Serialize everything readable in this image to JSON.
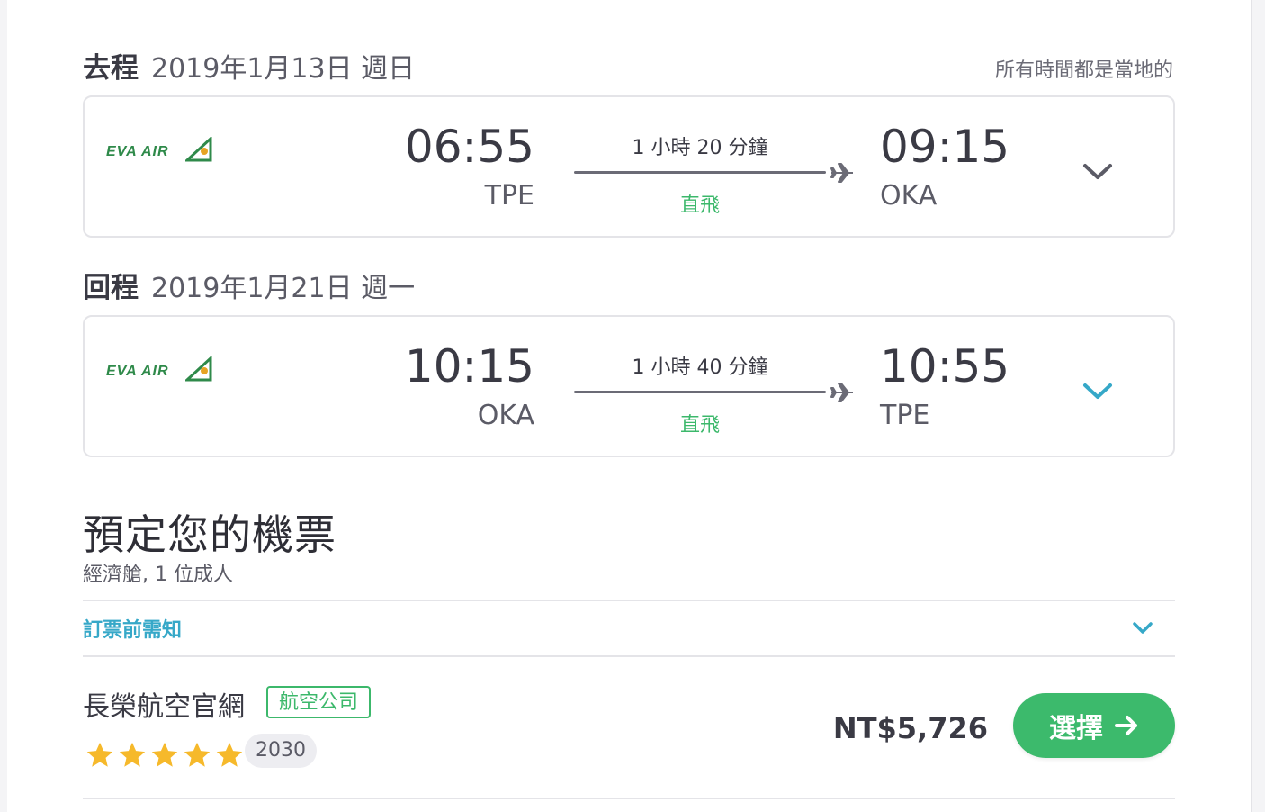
{
  "timezone_note": "所有時間都是當地的",
  "outbound": {
    "label": "去程",
    "date": "2019年1月13日 週日",
    "airline_logo_text": "EVA AIR",
    "depart_time": "06:55",
    "depart_code": "TPE",
    "duration": "1 小時 20 分鐘",
    "stops": "直飛",
    "arrive_time": "09:15",
    "arrive_code": "OKA",
    "chevron_color": "#5b5b66"
  },
  "return": {
    "label": "回程",
    "date": "2019年1月21日 週一",
    "airline_logo_text": "EVA AIR",
    "depart_time": "10:15",
    "depart_code": "OKA",
    "duration": "1 小時 40 分鐘",
    "stops": "直飛",
    "arrive_time": "10:55",
    "arrive_code": "TPE",
    "chevron_color": "#36a8c8"
  },
  "booking": {
    "title": "預定您的機票",
    "subtitle": "經濟艙, 1 位成人",
    "notice_label": "訂票前需知"
  },
  "vendor": {
    "name": "長榮航空官網",
    "badge": "航空公司",
    "rating_stars": 5,
    "review_count": "2030",
    "price": "NT$5,726",
    "select_label": "選擇"
  },
  "colors": {
    "accent_green": "#3cb86b",
    "link_blue": "#36a8c8",
    "star_yellow": "#f6b92b"
  }
}
